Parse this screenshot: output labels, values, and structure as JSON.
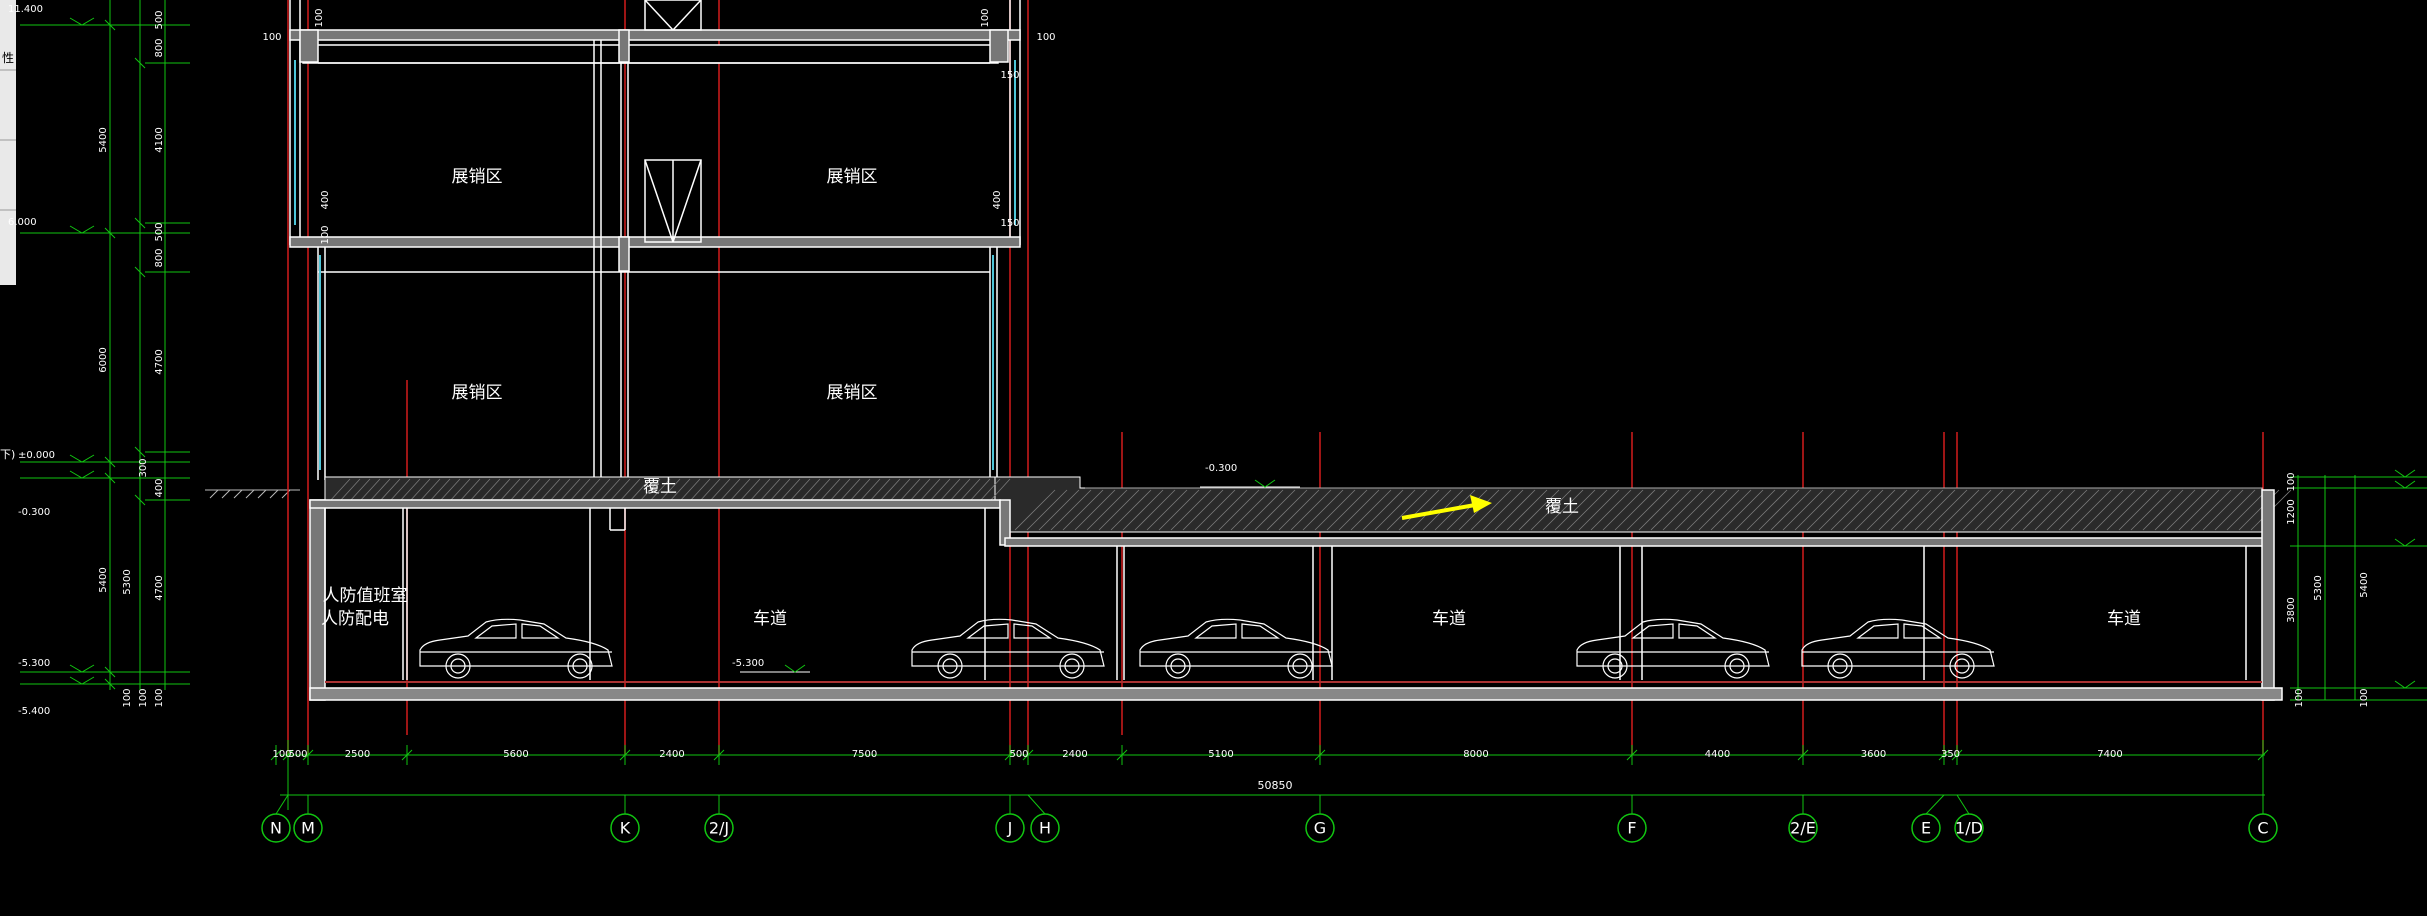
{
  "rooms": {
    "upper_left": "展销区",
    "upper_right": "展销区",
    "lower_left": "展销区",
    "lower_right": "展销区",
    "fill_left": "覆土",
    "fill_right": "覆土",
    "civil_defense_1": "人防值班室",
    "civil_defense_2": "人防配电",
    "driveway_1": "车道",
    "driveway_2": "车道",
    "driveway_3": "车道"
  },
  "elevations": {
    "top": "11.400",
    "level2": "6.000",
    "ground": "±0.000",
    "ground_neg": "-0.300",
    "basement_bot": "-5.300",
    "basement_base": "-5.400",
    "road": "-0.300",
    "basement_floor": "-5.300"
  },
  "left_dims_outer": [
    "5400",
    "6000",
    "5400"
  ],
  "left_dims_inner": [
    "500",
    "800",
    "4100",
    "500",
    "800",
    "4700",
    "300",
    "400",
    "100",
    "5300",
    "4700",
    "100",
    "100"
  ],
  "left_stub_text": "性",
  "left_stub_text2": "下)",
  "small_dims": [
    "100",
    "100",
    "400",
    "100",
    "100",
    "150",
    "400",
    "150",
    "100"
  ],
  "right_dims_inner": [
    "100",
    "1200",
    "3800",
    "100"
  ],
  "right_dims_outer": [
    "5300",
    "5400",
    "100"
  ],
  "bottom_dims": [
    "100",
    "500",
    "2500",
    "5600",
    "2400",
    "7500",
    "500",
    "2400",
    "5100",
    "8000",
    "4400",
    "3600",
    "350",
    "7400"
  ],
  "overall_dim": "50850",
  "axes": [
    "N",
    "M",
    "K",
    "2/J",
    "J",
    "H",
    "G",
    "F",
    "2/E",
    "E",
    "1/D",
    "C"
  ],
  "colors": {
    "background": "#000000",
    "wall": "#ffffff",
    "grid_line": "#d21c1c",
    "dimension": "#11c511",
    "arrow": "#ffff00",
    "glass": "#4ec6d8",
    "hatch": "#8c8c8c"
  }
}
